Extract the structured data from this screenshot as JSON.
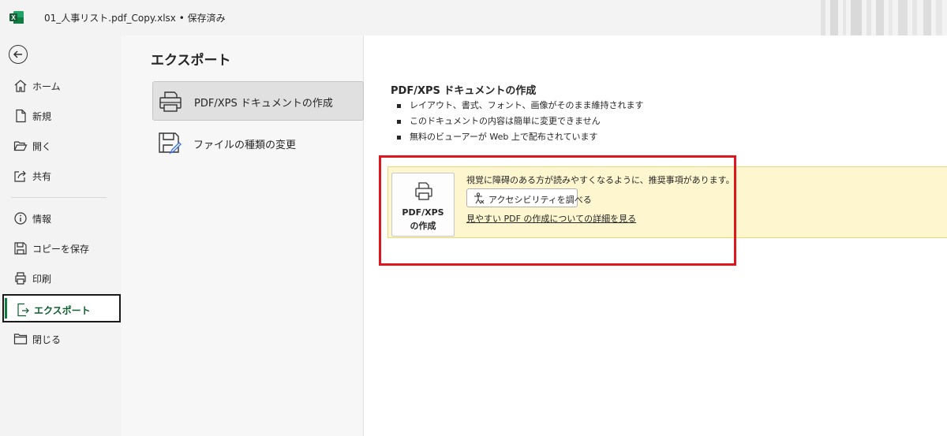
{
  "titlebar": {
    "filename": "01_人事リスト.pdf_Copy.xlsx",
    "separator": "•",
    "status": "保存済み"
  },
  "sidebar": {
    "items": [
      {
        "label": "ホーム",
        "icon": "home-icon"
      },
      {
        "label": "新規",
        "icon": "new-file-icon"
      },
      {
        "label": "開く",
        "icon": "open-folder-icon"
      },
      {
        "label": "共有",
        "icon": "share-icon"
      },
      {
        "label": "情報",
        "icon": "info-icon"
      },
      {
        "label": "コピーを保存",
        "icon": "save-icon"
      },
      {
        "label": "印刷",
        "icon": "print-icon"
      },
      {
        "label": "エクスポート",
        "icon": "export-icon"
      },
      {
        "label": "閉じる",
        "icon": "close-folder-icon"
      }
    ],
    "selected": "エクスポート"
  },
  "export": {
    "title": "エクスポート",
    "options": [
      {
        "label": "PDF/XPS ドキュメントの作成",
        "icon": "pdf-printer-icon"
      },
      {
        "label": "ファイルの種類の変更",
        "icon": "change-file-type-icon"
      }
    ]
  },
  "content": {
    "title": "PDF/XPS ドキュメントの作成",
    "bullets": [
      "レイアウト、書式、フォント、画像がそのまま維持されます",
      "このドキュメントの内容は簡単に変更できません",
      "無料のビューアーが Web 上で配布されています"
    ],
    "create_button": {
      "line1": "PDF/XPS",
      "line2": "の作成"
    },
    "notice": {
      "message": "視覚に障碍のある方が読みやすくなるように、推奨事項があります。",
      "check_button": "アクセシビリティを調べる",
      "link": "見やすい PDF の作成についての詳細を見る"
    }
  },
  "colors": {
    "accent": "#107c41",
    "highlight": "#e0161e",
    "notice_bg": "#fdf6cf"
  }
}
